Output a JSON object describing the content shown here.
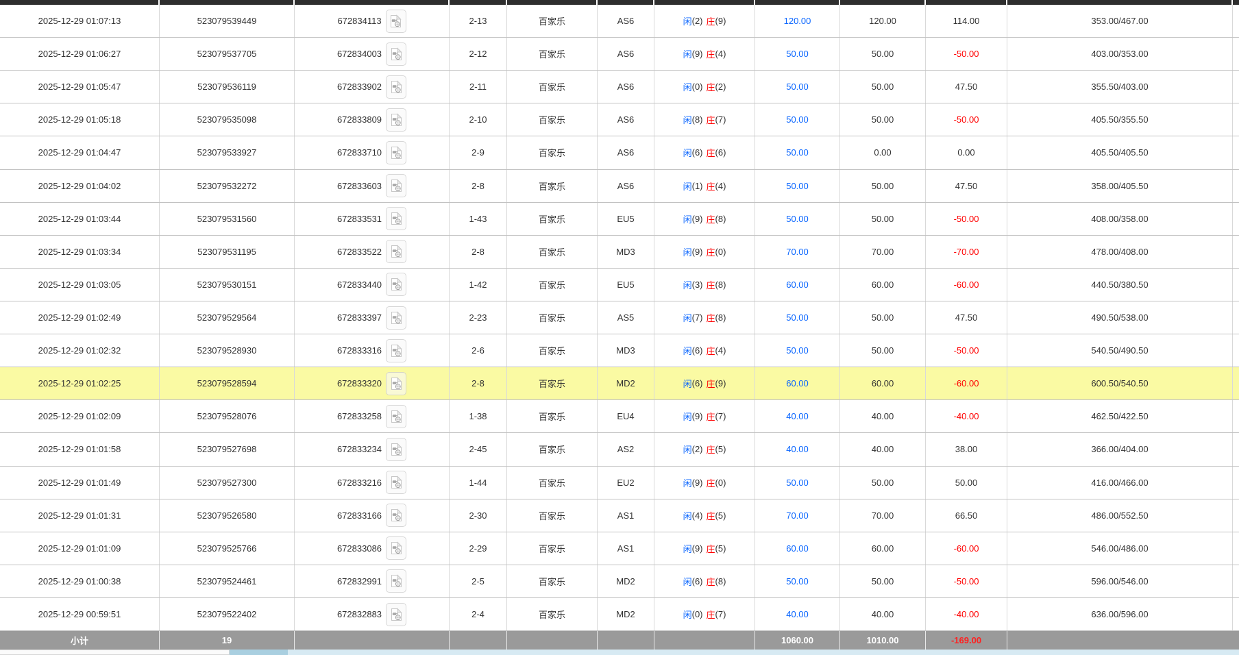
{
  "labels": {
    "player": "闲",
    "banker": "庄"
  },
  "footer": {
    "label": "小计",
    "count": "19",
    "bet_total": "1060.00",
    "valid_total": "1010.00",
    "winloss_total": "-169.00"
  },
  "colors": {
    "link_blue": "#0a66ff",
    "loss_red": "#ff0000",
    "highlight_yellow": "#fafaa3",
    "footer_grey": "#9a9a9a",
    "header_edge_dark": "#2e2e2e"
  },
  "icons": {
    "video_replay": "video-replay-icon"
  },
  "table": {
    "rows": [
      {
        "time": "2025-12-29 01:07:13",
        "bet_id": "523079539449",
        "game_id": "672834113",
        "round": "2-13",
        "game": "百家乐",
        "table_code": "AS6",
        "player_pts": "(2)",
        "banker_pts": "(9)",
        "bet": "120.00",
        "valid": "120.00",
        "winloss": "114.00",
        "balance": "353.00/467.00",
        "highlighted": false
      },
      {
        "time": "2025-12-29 01:06:27",
        "bet_id": "523079537705",
        "game_id": "672834003",
        "round": "2-12",
        "game": "百家乐",
        "table_code": "AS6",
        "player_pts": "(9)",
        "banker_pts": "(4)",
        "bet": "50.00",
        "valid": "50.00",
        "winloss": "-50.00",
        "balance": "403.00/353.00",
        "highlighted": false
      },
      {
        "time": "2025-12-29 01:05:47",
        "bet_id": "523079536119",
        "game_id": "672833902",
        "round": "2-11",
        "game": "百家乐",
        "table_code": "AS6",
        "player_pts": "(0)",
        "banker_pts": "(2)",
        "bet": "50.00",
        "valid": "50.00",
        "winloss": "47.50",
        "balance": "355.50/403.00",
        "highlighted": false
      },
      {
        "time": "2025-12-29 01:05:18",
        "bet_id": "523079535098",
        "game_id": "672833809",
        "round": "2-10",
        "game": "百家乐",
        "table_code": "AS6",
        "player_pts": "(8)",
        "banker_pts": "(7)",
        "bet": "50.00",
        "valid": "50.00",
        "winloss": "-50.00",
        "balance": "405.50/355.50",
        "highlighted": false
      },
      {
        "time": "2025-12-29 01:04:47",
        "bet_id": "523079533927",
        "game_id": "672833710",
        "round": "2-9",
        "game": "百家乐",
        "table_code": "AS6",
        "player_pts": "(6)",
        "banker_pts": "(6)",
        "bet": "50.00",
        "valid": "0.00",
        "winloss": "0.00",
        "balance": "405.50/405.50",
        "highlighted": false
      },
      {
        "time": "2025-12-29 01:04:02",
        "bet_id": "523079532272",
        "game_id": "672833603",
        "round": "2-8",
        "game": "百家乐",
        "table_code": "AS6",
        "player_pts": "(1)",
        "banker_pts": "(4)",
        "bet": "50.00",
        "valid": "50.00",
        "winloss": "47.50",
        "balance": "358.00/405.50",
        "highlighted": false
      },
      {
        "time": "2025-12-29 01:03:44",
        "bet_id": "523079531560",
        "game_id": "672833531",
        "round": "1-43",
        "game": "百家乐",
        "table_code": "EU5",
        "player_pts": "(9)",
        "banker_pts": "(8)",
        "bet": "50.00",
        "valid": "50.00",
        "winloss": "-50.00",
        "balance": "408.00/358.00",
        "highlighted": false
      },
      {
        "time": "2025-12-29 01:03:34",
        "bet_id": "523079531195",
        "game_id": "672833522",
        "round": "2-8",
        "game": "百家乐",
        "table_code": "MD3",
        "player_pts": "(9)",
        "banker_pts": "(0)",
        "bet": "70.00",
        "valid": "70.00",
        "winloss": "-70.00",
        "balance": "478.00/408.00",
        "highlighted": false
      },
      {
        "time": "2025-12-29 01:03:05",
        "bet_id": "523079530151",
        "game_id": "672833440",
        "round": "1-42",
        "game": "百家乐",
        "table_code": "EU5",
        "player_pts": "(3)",
        "banker_pts": "(8)",
        "bet": "60.00",
        "valid": "60.00",
        "winloss": "-60.00",
        "balance": "440.50/380.50",
        "highlighted": false
      },
      {
        "time": "2025-12-29 01:02:49",
        "bet_id": "523079529564",
        "game_id": "672833397",
        "round": "2-23",
        "game": "百家乐",
        "table_code": "AS5",
        "player_pts": "(7)",
        "banker_pts": "(8)",
        "bet": "50.00",
        "valid": "50.00",
        "winloss": "47.50",
        "balance": "490.50/538.00",
        "highlighted": false
      },
      {
        "time": "2025-12-29 01:02:32",
        "bet_id": "523079528930",
        "game_id": "672833316",
        "round": "2-6",
        "game": "百家乐",
        "table_code": "MD3",
        "player_pts": "(6)",
        "banker_pts": "(4)",
        "bet": "50.00",
        "valid": "50.00",
        "winloss": "-50.00",
        "balance": "540.50/490.50",
        "highlighted": false
      },
      {
        "time": "2025-12-29 01:02:25",
        "bet_id": "523079528594",
        "game_id": "672833320",
        "round": "2-8",
        "game": "百家乐",
        "table_code": "MD2",
        "player_pts": "(6)",
        "banker_pts": "(9)",
        "bet": "60.00",
        "valid": "60.00",
        "winloss": "-60.00",
        "balance": "600.50/540.50",
        "highlighted": true
      },
      {
        "time": "2025-12-29 01:02:09",
        "bet_id": "523079528076",
        "game_id": "672833258",
        "round": "1-38",
        "game": "百家乐",
        "table_code": "EU4",
        "player_pts": "(9)",
        "banker_pts": "(7)",
        "bet": "40.00",
        "valid": "40.00",
        "winloss": "-40.00",
        "balance": "462.50/422.50",
        "highlighted": false
      },
      {
        "time": "2025-12-29 01:01:58",
        "bet_id": "523079527698",
        "game_id": "672833234",
        "round": "2-45",
        "game": "百家乐",
        "table_code": "AS2",
        "player_pts": "(2)",
        "banker_pts": "(5)",
        "bet": "40.00",
        "valid": "40.00",
        "winloss": "38.00",
        "balance": "366.00/404.00",
        "highlighted": false
      },
      {
        "time": "2025-12-29 01:01:49",
        "bet_id": "523079527300",
        "game_id": "672833216",
        "round": "1-44",
        "game": "百家乐",
        "table_code": "EU2",
        "player_pts": "(9)",
        "banker_pts": "(0)",
        "bet": "50.00",
        "valid": "50.00",
        "winloss": "50.00",
        "balance": "416.00/466.00",
        "highlighted": false
      },
      {
        "time": "2025-12-29 01:01:31",
        "bet_id": "523079526580",
        "game_id": "672833166",
        "round": "2-30",
        "game": "百家乐",
        "table_code": "AS1",
        "player_pts": "(4)",
        "banker_pts": "(5)",
        "bet": "70.00",
        "valid": "70.00",
        "winloss": "66.50",
        "balance": "486.00/552.50",
        "highlighted": false
      },
      {
        "time": "2025-12-29 01:01:09",
        "bet_id": "523079525766",
        "game_id": "672833086",
        "round": "2-29",
        "game": "百家乐",
        "table_code": "AS1",
        "player_pts": "(9)",
        "banker_pts": "(5)",
        "bet": "60.00",
        "valid": "60.00",
        "winloss": "-60.00",
        "balance": "546.00/486.00",
        "highlighted": false
      },
      {
        "time": "2025-12-29 01:00:38",
        "bet_id": "523079524461",
        "game_id": "672832991",
        "round": "2-5",
        "game": "百家乐",
        "table_code": "MD2",
        "player_pts": "(6)",
        "banker_pts": "(8)",
        "bet": "50.00",
        "valid": "50.00",
        "winloss": "-50.00",
        "balance": "596.00/546.00",
        "highlighted": false
      },
      {
        "time": "2025-12-29 00:59:51",
        "bet_id": "523079522402",
        "game_id": "672832883",
        "round": "2-4",
        "game": "百家乐",
        "table_code": "MD2",
        "player_pts": "(0)",
        "banker_pts": "(7)",
        "bet": "40.00",
        "valid": "40.00",
        "winloss": "-40.00",
        "balance": "636.00/596.00",
        "highlighted": false
      }
    ]
  }
}
